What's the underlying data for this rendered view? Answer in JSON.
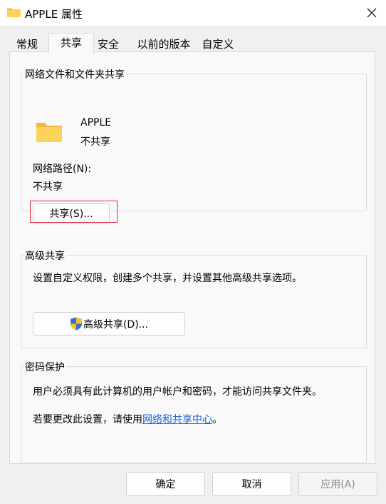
{
  "window": {
    "title": "APPLE 属性",
    "icon": "folder-icon",
    "close_icon": "close-icon"
  },
  "tabs": [
    {
      "label": "常规",
      "selected": false
    },
    {
      "label": "共享",
      "selected": true
    },
    {
      "label": "安全",
      "selected": false
    },
    {
      "label": "以前的版本",
      "selected": false
    },
    {
      "label": "自定义",
      "selected": false
    }
  ],
  "network_sharing": {
    "title": "网络文件和文件夹共享",
    "folder_name": "APPLE",
    "folder_status": "不共享",
    "network_path_label": "网络路径(N):",
    "network_path_value": "不共享",
    "share_button": "共享(S)..."
  },
  "advanced_sharing": {
    "title": "高级共享",
    "description": "设置自定义权限，创建多个共享，并设置其他高级共享选项。",
    "button": "高级共享(D)...",
    "button_icon": "uac-shield-icon"
  },
  "password_protection": {
    "title": "密码保护",
    "line1": "用户必须具有此计算机的用户帐户和密码，才能访问共享文件夹。",
    "line2_prefix": "若要更改此设置，请使用",
    "line2_link": "网络和共享中心",
    "line2_suffix": "。"
  },
  "footer": {
    "ok": "确定",
    "cancel": "取消",
    "apply": "应用(A)",
    "apply_enabled": false
  },
  "colors": {
    "link": "#1a64d2",
    "focus_rect": "#e0303a",
    "folder": "#f8c94a"
  }
}
